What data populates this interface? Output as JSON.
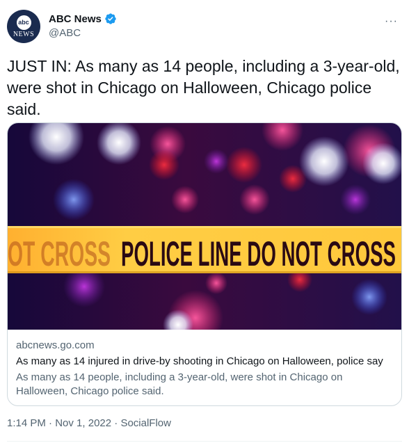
{
  "author": {
    "avatar_logo_text": "abc",
    "avatar_sub_text": "NEWS",
    "display_name": "ABC News",
    "handle": "@ABC",
    "verified_badge_color": "#1d9bf0"
  },
  "tweet": {
    "text": "JUST IN: As many as 14 people, including a 3-year-old, were shot in Chicago on Halloween, Chicago police said."
  },
  "card": {
    "image_tape_left": "OT CROSS",
    "image_tape_main": "POLICE LINE DO NOT CROSS",
    "domain": "abcnews.go.com",
    "title": "As many as 14 injured in drive-by shooting in Chicago on Halloween, police say",
    "description": "As many as 14 people, including a 3-year-old, were shot in Chicago on Halloween, Chicago police said."
  },
  "meta": {
    "time": "1:14 PM",
    "separator": "·",
    "date": "Nov 1, 2022",
    "source": "SocialFlow"
  },
  "icons": {
    "more": "more-horizontal-icon",
    "verified": "verified-badge-icon"
  }
}
